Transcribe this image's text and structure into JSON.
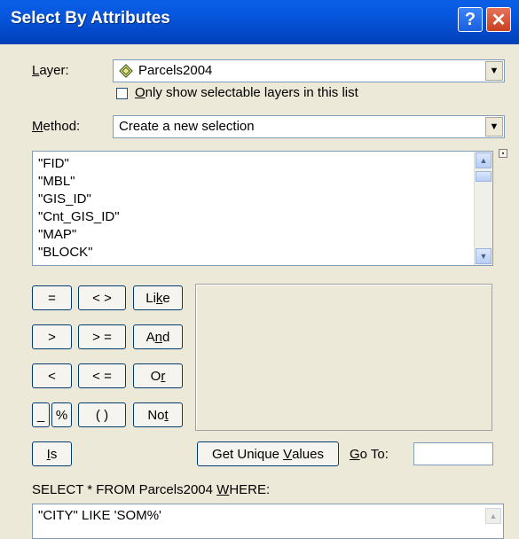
{
  "window": {
    "title": "Select By Attributes",
    "help_glyph": "?",
    "close_glyph": "✕"
  },
  "layer": {
    "label_first": "L",
    "label_rest": "ayer:",
    "value": "Parcels2004",
    "icon": "layer-diamond-icon"
  },
  "selectable_checkbox": {
    "label_first": "O",
    "label_rest": "nly show selectable layers in this list",
    "checked": false
  },
  "method": {
    "label_first": "M",
    "label_rest": "ethod:",
    "value": "Create a new selection"
  },
  "fields": [
    "\"FID\"",
    "\"MBL\"",
    "\"GIS_ID\"",
    "\"Cnt_GIS_ID\"",
    "\"MAP\"",
    "\"BLOCK\""
  ],
  "operators": {
    "eq": "=",
    "ne": "< >",
    "like_pre": "Li",
    "like_u": "k",
    "like_post": "e",
    "gt": ">",
    "ge": "> =",
    "and_pre": "A",
    "and_u": "n",
    "and_post": "d",
    "lt": "<",
    "le": "< =",
    "or_pre": "O",
    "or_u": "r",
    "underscore": "_",
    "percent": "%",
    "parens": "( )",
    "not_pre": "No",
    "not_u": "t",
    "is_u": "I",
    "is_post": "s"
  },
  "unique_values": {
    "pre": "Get Unique ",
    "u": "V",
    "post": "alues"
  },
  "goto": {
    "u": "G",
    "post": "o To:"
  },
  "sql": {
    "prefix_label": "SELECT * FROM Parcels2004 ",
    "where_u": "W",
    "where_post": "HERE:",
    "expression": "\"CITY\" LIKE 'SOM%'"
  },
  "colors": {
    "title_bar": "#0a5ee6",
    "dialog_bg": "#ece9d8",
    "close_button": "#c7401f"
  }
}
